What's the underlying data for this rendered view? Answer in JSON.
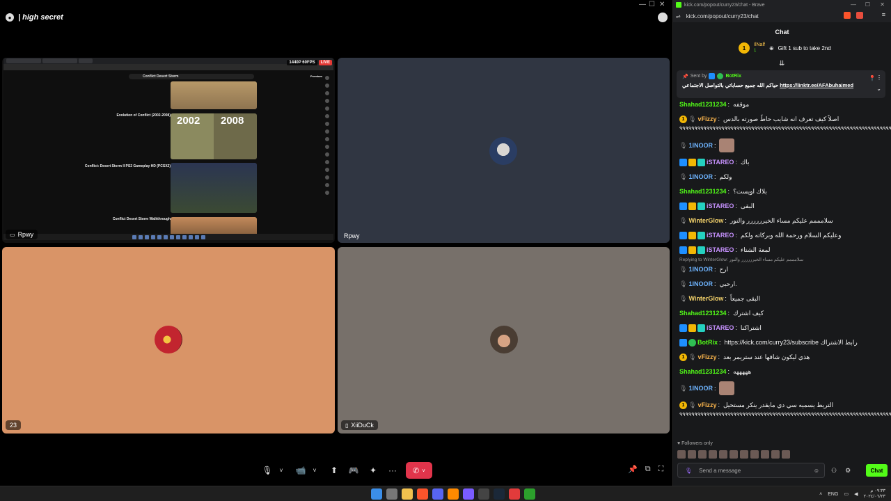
{
  "call": {
    "server_name": "| high secret",
    "tiles": [
      {
        "label": "Rpwy"
      },
      {
        "label": "Rpwy"
      },
      {
        "label": "23"
      },
      {
        "label": "XiiDuCk"
      }
    ],
    "screen": {
      "yt_header": "Conflict Desert Storm",
      "quality": "1440P 60FPS",
      "live": "LIVE",
      "thumb_years": [
        "2002",
        "2008"
      ],
      "videos": [
        {
          "title": "Evolution of Conflict (2002-2008)"
        },
        {
          "title": "Conflict: Desert Storm II PS2 Gameplay HD (PCSX2)"
        },
        {
          "title": "Conflict Desert Storm Walkthrough"
        }
      ],
      "sidebar_label": "Premium"
    },
    "controls": {
      "mic": "🎙",
      "chevron": "˅",
      "video": "📹",
      "share": "⬆",
      "activity": "🎮",
      "soundboard": "✦",
      "more": "···",
      "leave": "✆"
    }
  },
  "taskbar": {
    "lang": "ENG",
    "time": "٠٩:٣٣ م",
    "date": "٢٠٢٤/٠٦/٢٣"
  },
  "browser": {
    "title": "kick.com/popout/curry23/chat - Brave",
    "url": "kick.com/popout/curry23/chat",
    "chat_header": "Chat",
    "gift": {
      "user": "IlNalf",
      "count": "1",
      "text": "Gift 1 sub to take 2nd"
    },
    "pinned": {
      "sent_by": "Sent by",
      "bot": "BotRix",
      "message": "حياكم الله جميع حساباتي بالتواصل الاجتماعي",
      "link": "https://linktr.ee/AFAbuhaimed"
    },
    "messages": [
      {
        "user": "Shahad1231234",
        "color": "#53fc18",
        "text": "موقفه"
      },
      {
        "user": "vFizzy",
        "color": "#ffb84d",
        "text": "اصلاً كيف تعرف انه شايب حاطً صورته بالدس",
        "extra": "٩٩٩٩٩٩٩٩٩٩٩٩٩٩٩٩٩٩٩٩٩٩٩٩٩٩٩٩٩٩٩٩٩٩٩٩٩٩٩٩٩٩٩٩٩٩٩٩٩٩٩٩٩٩٩٩٩٩٩٩٩٩٩٩٩٩٩٩٩٩٩٩٩٩٩٩٩٩٩"
      },
      {
        "user": "1INOOR",
        "color": "#6eb4ff",
        "text": ""
      },
      {
        "user": "iSTAREO",
        "color": "#c792ff",
        "text": "باك"
      },
      {
        "user": "1INOOR",
        "color": "#6eb4ff",
        "text": "ولكم"
      },
      {
        "user": "Shahad1231234",
        "color": "#53fc18",
        "text": "بلاك اويست؟"
      },
      {
        "user": "iSTAREO",
        "color": "#c792ff",
        "text": "البقى"
      },
      {
        "user": "WinterGlow",
        "color": "#f5d36b",
        "text": "سلامممم عليكم مساء الخيرررررر والنور"
      },
      {
        "user": "iSTAREO",
        "color": "#c792ff",
        "text": "وعليكم السلام ورحمة الله وبركاته ولكم"
      },
      {
        "user": "iSTAREO",
        "color": "#c792ff",
        "text": "لمعة الشتاء"
      },
      {
        "user": "1INOOR",
        "color": "#6eb4ff",
        "text": "ارح",
        "reply": "Replying to WinterGlow: سلامممم عليكم مساء الخيرررررر والنور"
      },
      {
        "user": "1INOOR",
        "color": "#6eb4ff",
        "text": "ارحبي."
      },
      {
        "user": "WinterGlow",
        "color": "#f5d36b",
        "text": "البقى جميعاً"
      },
      {
        "user": "Shahad1231234",
        "color": "#53fc18",
        "text": "كيف اشترك"
      },
      {
        "user": "iSTAREO",
        "color": "#c792ff",
        "text": "اشتراكنا"
      },
      {
        "user": "BotRix",
        "color": "#53fc18",
        "text": "https://kick.com/curry23/subscribe رابط الاشتراك"
      },
      {
        "user": "vFizzy",
        "color": "#ffb84d",
        "text": "هذي ليكون شافها عند ستريمر بعد"
      },
      {
        "user": "Shahad1231234",
        "color": "#53fc18",
        "text": "هههههه"
      },
      {
        "user": "1INOOR",
        "color": "#6eb4ff",
        "text": ""
      },
      {
        "user": "vFizzy",
        "color": "#ffb84d",
        "text": "التريط يسميه سي دي مايقدر ينكر مستحيل",
        "extra": "٩٩٩٩٩٩٩٩٩٩٩٩٩٩٩٩٩٩٩٩٩٩٩٩٩٩٩٩٩٩٩٩٩٩٩٩٩٩٩٩٩٩٩٩٩٩٩٩٩٩٩٩٩٩٩٩٩٩٩٩٩٩٩٩٩٩٩٩٩٩٩٩٩٩٩٩٩٩٩٩"
      }
    ],
    "followers_only": "Followers only",
    "composer_placeholder": "Send a message",
    "send_label": "Chat"
  }
}
